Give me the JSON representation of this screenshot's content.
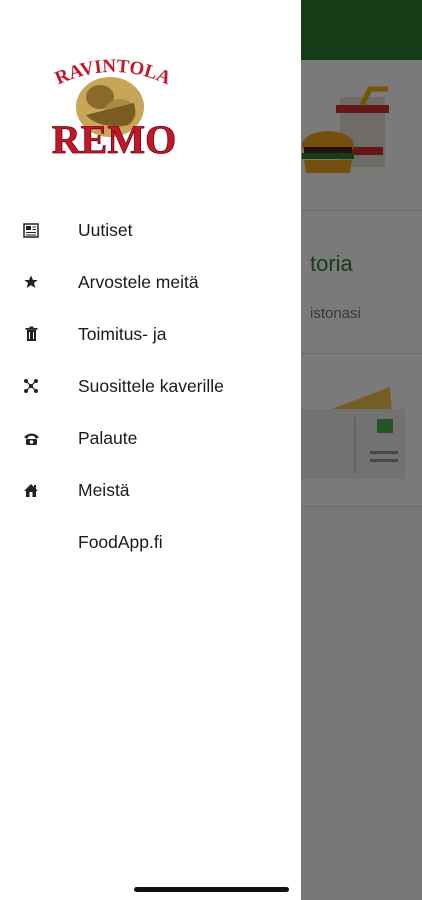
{
  "drawer": {
    "logo": {
      "line1": "RAVINTOLA",
      "line2": "REMO"
    },
    "items": [
      {
        "icon": "newspaper-icon",
        "label": "Uutiset"
      },
      {
        "icon": "star-icon",
        "label": "Arvostele meitä"
      },
      {
        "icon": "trash-icon",
        "label": "Toimitus- ja"
      },
      {
        "icon": "share-icon",
        "label": "Suosittele kaverille"
      },
      {
        "icon": "phone-icon",
        "label": "Palaute"
      },
      {
        "icon": "home-icon",
        "label": "Meistä"
      },
      {
        "icon": "",
        "label": "FoodApp.fi"
      }
    ]
  },
  "background": {
    "card2_title": "toria",
    "card2_subtitle": "istonasi"
  },
  "colors": {
    "accent_green": "#2e7d32",
    "logo_red": "#c0182a"
  }
}
